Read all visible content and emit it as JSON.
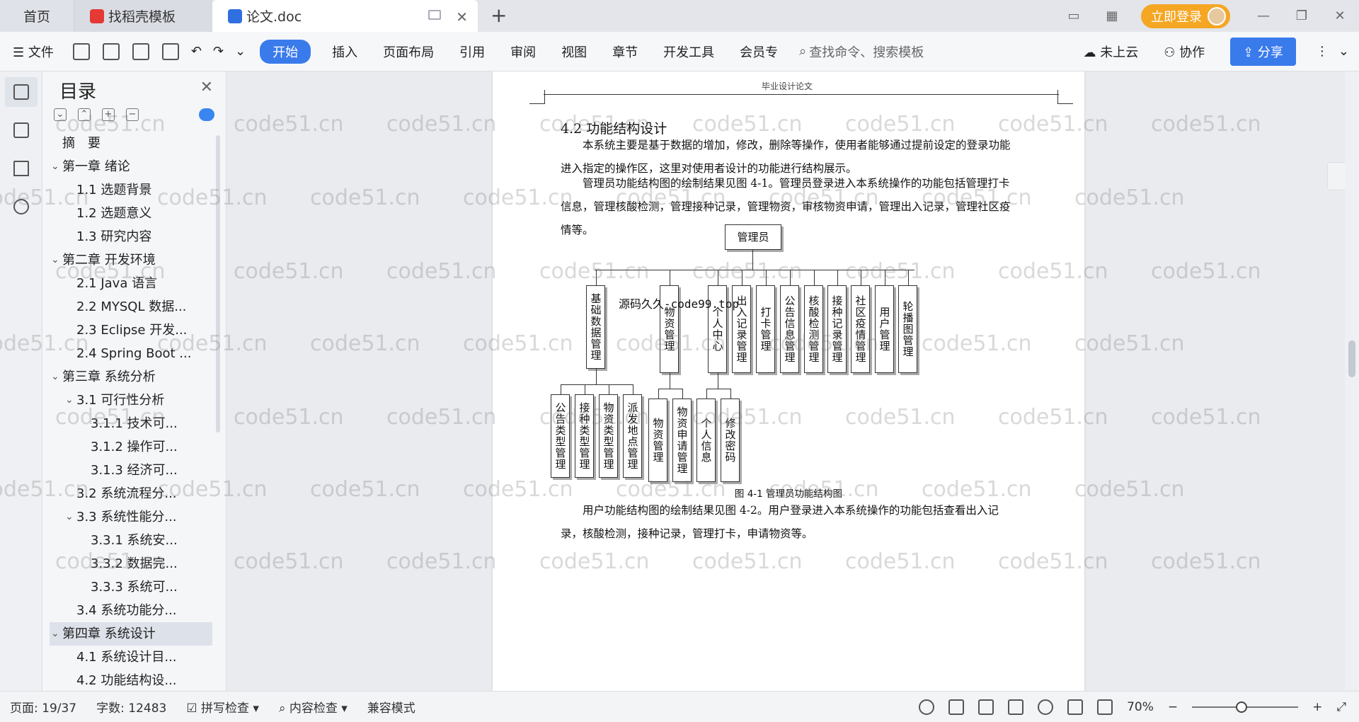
{
  "tabs": {
    "home": "首页",
    "daoke": "找稻壳模板",
    "doc": "论文.doc",
    "new_tab": "+"
  },
  "account": {
    "login": "立即登录"
  },
  "ribbon": {
    "file": "文件",
    "start": "开始",
    "insert": "插入",
    "layout": "页面布局",
    "references": "引用",
    "review": "审阅",
    "view": "视图",
    "chapter": "章节",
    "devtools": "开发工具",
    "member": "会员专",
    "search_placeholder": "查找命令、搜索模板",
    "cloud": "未上云",
    "collab": "协作",
    "share": "分享"
  },
  "toc": {
    "title": "目录",
    "items": [
      {
        "label": "摘　要",
        "level": 1,
        "chev": ""
      },
      {
        "label": "第一章  绪论",
        "level": 1,
        "chev": "⌄"
      },
      {
        "label": "1.1  选题背景",
        "level": 2,
        "chev": ""
      },
      {
        "label": "1.2  选题意义",
        "level": 2,
        "chev": ""
      },
      {
        "label": "1.3  研究内容",
        "level": 2,
        "chev": ""
      },
      {
        "label": "第二章  开发环境",
        "level": 1,
        "chev": "⌄"
      },
      {
        "label": "2.1 Java 语言",
        "level": 2,
        "chev": ""
      },
      {
        "label": "2.2 MYSQL 数据...",
        "level": 2,
        "chev": ""
      },
      {
        "label": "2.3 Eclipse 开发...",
        "level": 2,
        "chev": ""
      },
      {
        "label": "2.4 Spring Boot ...",
        "level": 2,
        "chev": ""
      },
      {
        "label": "第三章  系统分析",
        "level": 1,
        "chev": "⌄"
      },
      {
        "label": "3.1 可行性分析",
        "level": 2,
        "chev": "⌄"
      },
      {
        "label": "3.1.1 技术可...",
        "level": 3,
        "chev": ""
      },
      {
        "label": "3.1.2 操作可...",
        "level": 3,
        "chev": ""
      },
      {
        "label": "3.1.3 经济可...",
        "level": 3,
        "chev": ""
      },
      {
        "label": "3.2 系统流程分...",
        "level": 2,
        "chev": ""
      },
      {
        "label": "3.3 系统性能分...",
        "level": 2,
        "chev": "⌄"
      },
      {
        "label": "3.3.1 系统安...",
        "level": 3,
        "chev": ""
      },
      {
        "label": "3.3.2 数据完...",
        "level": 3,
        "chev": ""
      },
      {
        "label": "3.3.3 系统可...",
        "level": 3,
        "chev": ""
      },
      {
        "label": "3.4 系统功能分...",
        "level": 2,
        "chev": ""
      },
      {
        "label": "第四章  系统设计",
        "level": 1,
        "chev": "⌄",
        "selected": true
      },
      {
        "label": "4.1  系统设计目...",
        "level": 2,
        "chev": ""
      },
      {
        "label": "4.2 功能结构设...",
        "level": 2,
        "chev": ""
      }
    ]
  },
  "document": {
    "header": "毕业设计论文",
    "heading": "4.2 功能结构设计",
    "para1": "本系统主要是基于数据的增加，修改，删除等操作，使用者能够通过提前设定的登录功能进入指定的操作区，这里对使用者设计的功能进行结构展示。",
    "para2": "管理员功能结构图的绘制结果见图 4-1。管理员登录进入本系统操作的功能包括管理打卡信息，管理核酸检测，管理接种记录，管理物资，审核物资申请，管理出入记录，管理社区疫情等。",
    "caption": "图 4-1  管理员功能结构图",
    "para3": "用户功能结构图的绘制结果见图 4-2。用户登录进入本系统操作的功能包括查看出入记录，核酸检测，接种记录，管理打卡，申请物资等。",
    "overlay_tag": "源码久久-code99.top",
    "watermark": "code51.cn"
  },
  "diagram": {
    "root": "管理员",
    "level1": [
      "基础数据管理",
      "物资管理",
      "个人中心",
      "出入记录管理",
      "打卡管理",
      "公告信息管理",
      "核酸检测管理",
      "接种记录管理",
      "社区疫情管理",
      "用户管理",
      "轮播图管理"
    ],
    "level2_basic": [
      "公告类型管理",
      "接种类型管理",
      "物资类型管理",
      "派发地点管理"
    ],
    "level2_supply": [
      "物资管理",
      "物资申请管理"
    ],
    "level2_personal": [
      "个人信息",
      "修改密码"
    ]
  },
  "status": {
    "page": "页面: 19/37",
    "words": "字数: 12483",
    "spell": "拼写检查",
    "content": "内容检查",
    "compat": "兼容模式",
    "zoom": "70%"
  },
  "colors": {
    "accent": "#3a7bec",
    "login": "#f5a623"
  }
}
